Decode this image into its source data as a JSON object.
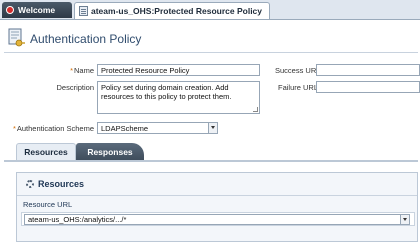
{
  "tabs": {
    "welcome": "Welcome",
    "policy": "ateam-us_OHS:Protected Resource Policy"
  },
  "page": {
    "title": "Authentication Policy"
  },
  "form": {
    "name_label": "Name",
    "name_value": "Protected Resource Policy",
    "description_label": "Description",
    "description_value": "Policy set during domain creation. Add resources to this policy to protect them.",
    "scheme_label": "Authentication Scheme",
    "scheme_value": "LDAPScheme",
    "success_url_label": "Success URL",
    "failure_url_label": "Failure URL",
    "required_marker": "*"
  },
  "subtabs": {
    "resources": "Resources",
    "responses": "Responses"
  },
  "resources_panel": {
    "title": "Resources",
    "column_header": "Resource URL",
    "rows": [
      "ateam-us_OHS:/analytics/.../*"
    ]
  },
  "colors": {
    "title": "#314d6e",
    "required": "#d26b00",
    "tab_dark": "#3f4d5c"
  },
  "icons": [
    "oracle-logo-icon",
    "document-icon",
    "policy-key-icon",
    "gear-icon",
    "dropdown-arrow-icon"
  ]
}
